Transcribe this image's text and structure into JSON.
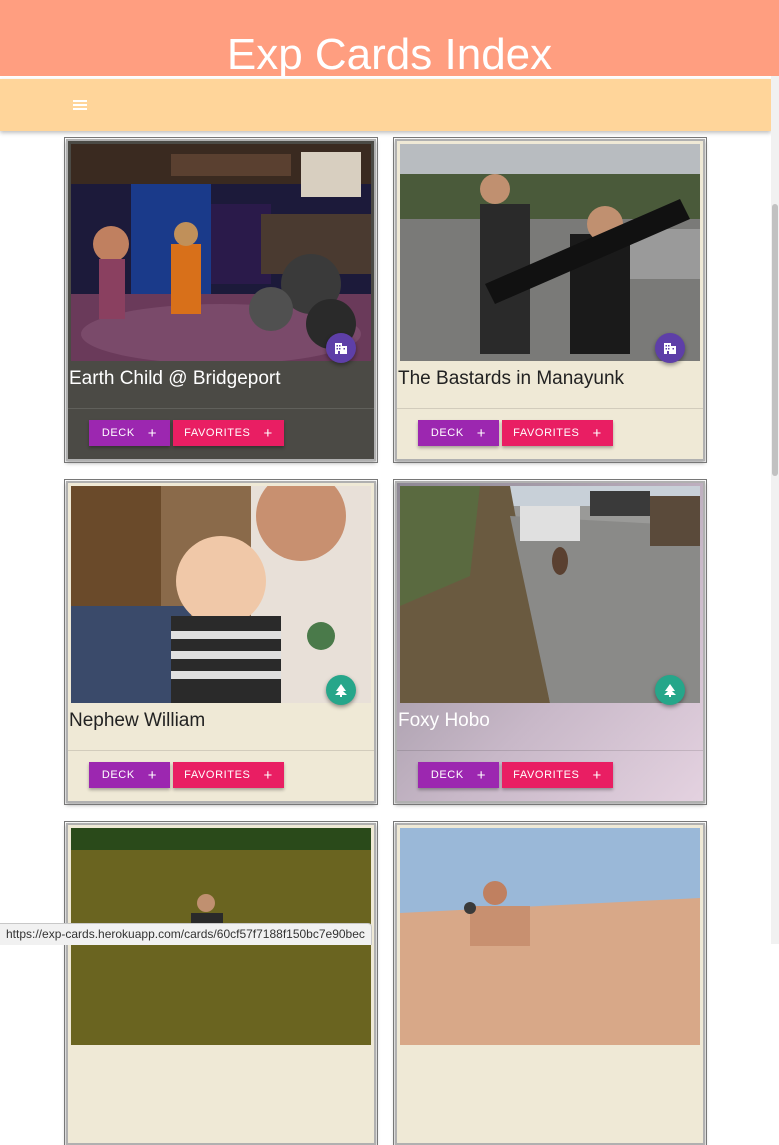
{
  "header": {
    "title": "Exp Cards Index",
    "menu_icon": "hamburger-menu-icon"
  },
  "colors": {
    "title_bar": "#ff9e80",
    "nav_bar": "#ffd59a",
    "deck_button": "#9c27b0",
    "favorites_button": "#e91e63",
    "city_badge": "#5e3fa8",
    "nature_badge": "#26a68a"
  },
  "cards": [
    {
      "title": "Earth Child @ Bridgeport",
      "badge_icon": "building-icon",
      "photo": "band-playing-in-bar",
      "deck_label": "DECK",
      "favorites_label": "FAVORITES",
      "plus": "+"
    },
    {
      "title": "The Bastards in Manayunk",
      "badge_icon": "building-icon",
      "photo": "two-men-carrying-guitar-case",
      "deck_label": "DECK",
      "favorites_label": "FAVORITES",
      "plus": "+"
    },
    {
      "title": "Nephew William",
      "badge_icon": "tree-icon",
      "photo": "child-with-man",
      "deck_label": "DECK",
      "favorites_label": "FAVORITES",
      "plus": "+"
    },
    {
      "title": "Foxy Hobo",
      "badge_icon": "tree-icon",
      "photo": "fox-on-road",
      "deck_label": "DECK",
      "favorites_label": "FAVORITES",
      "plus": "+"
    },
    {
      "title": "",
      "badge_icon": "",
      "photo": "person-in-lake"
    },
    {
      "title": "",
      "badge_icon": "",
      "photo": "person-on-sand-dune"
    }
  ],
  "status_bar": {
    "url": "https://exp-cards.herokuapp.com/cards/60cf57f7188f150bc7e90bec"
  }
}
